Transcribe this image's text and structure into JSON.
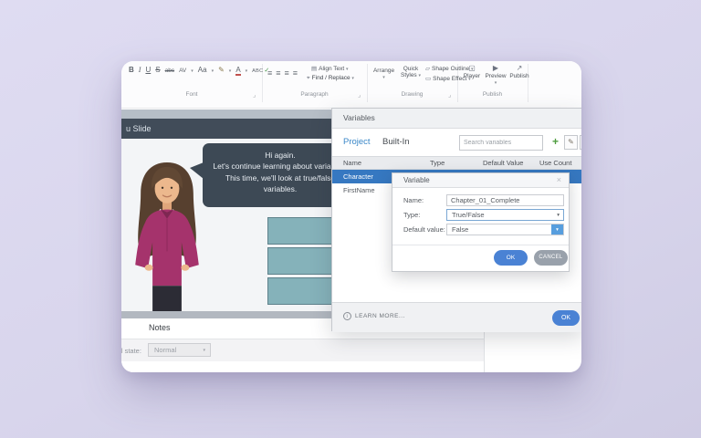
{
  "colors": {
    "background": "#d8d5ec",
    "accent_blue": "#4a82d4",
    "selected_row_blue": "#3678c1",
    "active_tab_blue": "#3a87c8",
    "plus_green": "#4f9d3f",
    "slide_header": "#414c59",
    "speech_bubble": "#3d4955",
    "teal_box": "#85b2ba",
    "cancel_gray": "#99a1ab"
  },
  "icons": {
    "caret": "▾",
    "launcher": "⌟",
    "align_lines": "≡",
    "binoculars": "⌖",
    "shape_outline": "▱",
    "shape_effect": "▭",
    "align_text_icon": "▤",
    "plus": "+",
    "edit_pencil": "✎",
    "extra_doc": "▤",
    "close_x": "×",
    "info_i": "i",
    "check": "✓",
    "player": "▢",
    "preview": "▶",
    "publish": "↗"
  },
  "ribbon": {
    "font_group": {
      "label": "Font",
      "bold": "B",
      "italic": "I",
      "underline": "U",
      "strike": "S",
      "clear": "abc",
      "spacing": "AV",
      "case": "Aa",
      "font_color": "A",
      "spell_abc": "ABC"
    },
    "paragraph_group": {
      "label": "Paragraph",
      "align_text": "Align Text",
      "find_replace": "Find / Replace"
    },
    "drawing_group": {
      "label": "Drawing",
      "arrange": "Arrange",
      "quick_styles": "Quick Styles",
      "shape_outline": "Shape Outline",
      "shape_effect": "Shape Effect"
    },
    "publish_group": {
      "label": "Publish",
      "player": "Player",
      "preview": "Preview",
      "publish": "Publish"
    }
  },
  "slide": {
    "tab_title": "u Slide",
    "speech_lines": [
      "Hi again.",
      "Let's continue learning about variables.",
      "This time, we'll look at true/false",
      "variables."
    ]
  },
  "notes": {
    "tab_label": "Notes",
    "state_label": "Initial state:",
    "state_value": "Normal"
  },
  "variables_dialog": {
    "title": "Variables",
    "tab_project": "Project",
    "tab_builtin": "Built-In",
    "search_placeholder": "Search variables",
    "columns": [
      "Name",
      "Type",
      "Default Value",
      "Use Count"
    ],
    "rows": [
      {
        "name": "Character"
      },
      {
        "name": "FirstName"
      }
    ],
    "learn_more": "LEARN MORE...",
    "ok_label": "OK"
  },
  "variable_modal": {
    "title": "Variable",
    "name_label": "Name:",
    "name_value": "Chapter_01_Complete",
    "type_label": "Type:",
    "type_value": "True/False",
    "default_label": "Default value:",
    "default_value": "False",
    "ok_label": "OK",
    "cancel_label": "CANCEL"
  }
}
